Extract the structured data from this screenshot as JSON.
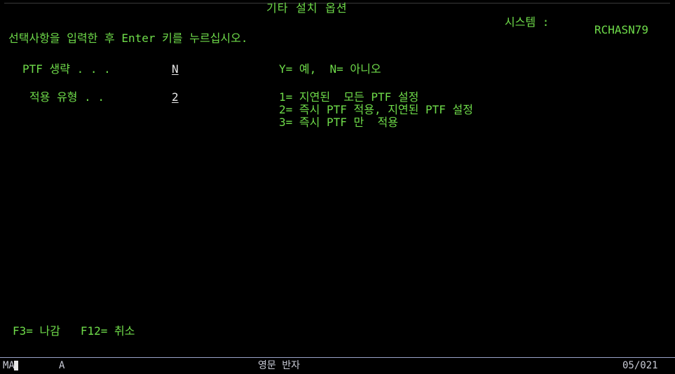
{
  "header": {
    "title": "기타 설치 옵션",
    "system_label": "시스템 :",
    "system_value": "RCHASN79"
  },
  "instruction": "선택사항을 입력한 후 Enter 키를 누르십시오.",
  "fields": [
    {
      "label": "PTF 생략 . . .",
      "value": "N",
      "options": [
        "Y= 예,  N= 아니오"
      ]
    },
    {
      "label": "적용 유형 . .",
      "value": "2",
      "options": [
        "1= 지연된  모든 PTF 설정",
        "2= 즉시 PTF 적용, 지연된 PTF 설정",
        "3= 즉시 PTF 만  적용"
      ]
    }
  ],
  "function_keys": "F3= 나감   F12= 취소",
  "status_bar": {
    "session": "MA",
    "mode_indicator": "A",
    "input_mode": "영문 반자",
    "cursor_position": "05/021"
  },
  "colors": {
    "background": "#000000",
    "text_green": "#6fdc4a",
    "field_white": "#e8e8e8",
    "status_border": "#9aa3c9"
  }
}
